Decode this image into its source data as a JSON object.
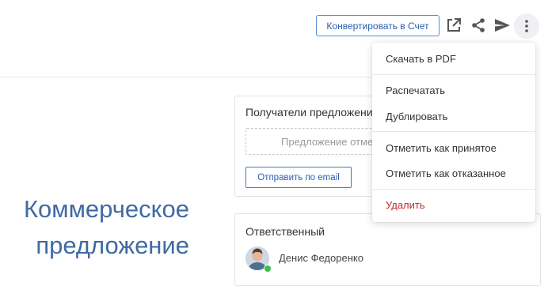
{
  "toolbar": {
    "convert_label": "Конвертировать в Счет",
    "icons": [
      "open-external-icon",
      "share-icon",
      "send-icon",
      "more-vertical-icon"
    ]
  },
  "recipients_card": {
    "title": "Получатели предложения",
    "placeholder": "Предложение отме",
    "email_button": "Отправить по email"
  },
  "document_title": {
    "line1": "Коммерческое",
    "line2": "предложение"
  },
  "responsible_card": {
    "title": "Ответственный",
    "person_name": "Денис Федоренко",
    "status": "online"
  },
  "menu": {
    "items": [
      {
        "label": "Скачать в PDF"
      },
      {
        "label": "Распечатать"
      },
      {
        "label": "Дублировать"
      },
      {
        "label": "Отметить как принятое"
      },
      {
        "label": "Отметить как отказанное"
      },
      {
        "label": "Удалить"
      }
    ]
  },
  "colors": {
    "accent": "#2a5db0",
    "title_blue": "#3f6aa3",
    "danger": "#c62828",
    "online": "#3ac14a"
  }
}
